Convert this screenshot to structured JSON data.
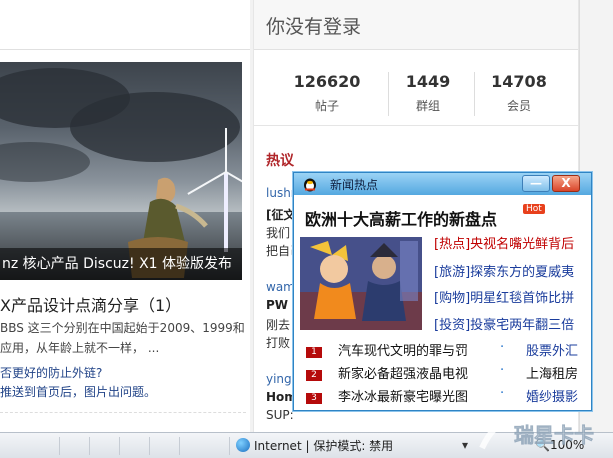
{
  "left": {
    "hero_caption": "nz 核心产品 Discuz! X1 体验版发布",
    "article_title": "X产品设计点滴分享（1）",
    "summary_lines": [
      "BBS 这三个分别在中国起始于2009、1999和",
      "应用，从年龄上就不一样，  ..."
    ],
    "links": [
      "否更好的防止外链?",
      "推送到首页后，图片出问题。"
    ]
  },
  "right": {
    "header": "你没有登录",
    "stats": [
      {
        "value": "126620",
        "label": "帖子"
      },
      {
        "value": "1449",
        "label": "群组"
      },
      {
        "value": "14708",
        "label": "会员"
      }
    ],
    "hot_title": "热议",
    "posts": [
      {
        "user": "lushn",
        "title": "[征文",
        "lines": [
          "我们",
          "把自己"
        ]
      },
      {
        "user": "waml",
        "title": "PW",
        "lines": [
          "刚去",
          "打败"
        ]
      },
      {
        "user": "yingh",
        "title": "Hom",
        "lines": [
          "SUP:"
        ]
      }
    ]
  },
  "statusbar": {
    "zone": "Internet | 保护模式: 禁用",
    "zoom": "100%"
  },
  "popup": {
    "title": "新闻热点",
    "min_label": "—",
    "close_label": "X",
    "headline": "欧洲十大高薪工作的新盘点",
    "badge": "Hot",
    "side_news": [
      {
        "tag": "[热点]",
        "text": "央视名嘴光鲜背后"
      },
      {
        "tag": "[旅游]",
        "text": "探索东方的夏威夷"
      },
      {
        "tag": "[购物]",
        "text": "明星红毯首饰比拼"
      },
      {
        "tag": "[投资]",
        "text": "投豪宅两年翻三倍"
      }
    ],
    "rank": [
      {
        "num": "1",
        "text": "汽车现代文明的罪与罚",
        "side": "股票外汇"
      },
      {
        "num": "2",
        "text": "新家必备超强液晶电视",
        "side": "上海租房"
      },
      {
        "num": "3",
        "text": "李冰冰最新豪宅曝光图",
        "side": "婚纱摄影"
      }
    ]
  },
  "watermark": "瑞星卡卡",
  "colors": {
    "popup_border": "#2f84c4",
    "hot_red": "#c00000",
    "link_blue": "#1a3c9c",
    "stat_title": "#b0262a"
  }
}
